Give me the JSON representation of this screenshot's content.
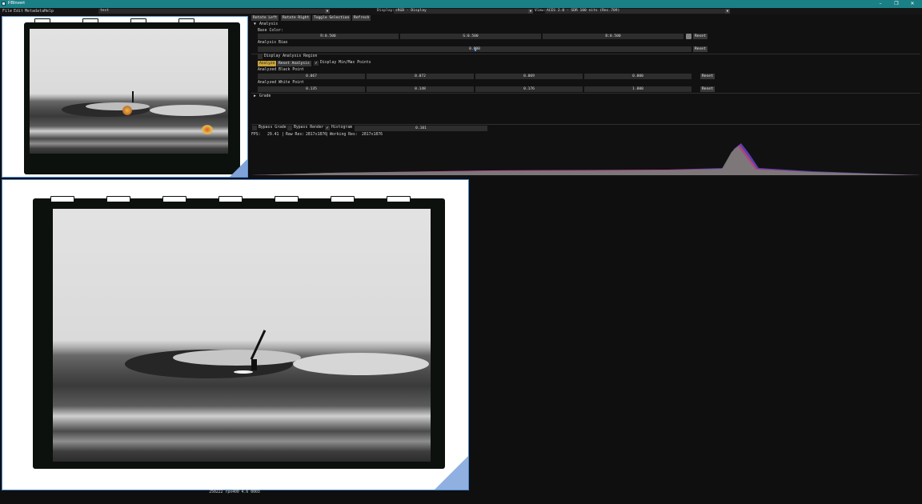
{
  "window": {
    "title": "FBInvert",
    "icon": "app-icon",
    "controls": [
      "–",
      "❐",
      "✕"
    ]
  },
  "menu": [
    "File",
    "Edit",
    "Metadata",
    "Help"
  ],
  "toolbar": {
    "file_combo": "test",
    "display_label": "Display:",
    "display_value": "sRGB - Display",
    "view_label": "View:",
    "view_value": "ACES 2.0 - SDR 100 nits (Rec.709)"
  },
  "actions": [
    "Rotate Left",
    "Rotate Right",
    "Toggle Selection",
    "Refresh"
  ],
  "analysis": {
    "header": "Analysis",
    "expander_icon": "triangle-down-icon",
    "base_color_label": "Base Color:",
    "base_color_values": [
      "R:0.500",
      "G:0.500",
      "B:0.500"
    ],
    "base_color_swatch": "#808080",
    "analysis_bias_label": "Analysis Bias",
    "analysis_bias_value": "0.000",
    "analysis_bias_fraction": 0.5,
    "display_region_label": "Display Analysis Region",
    "display_region_checked": false,
    "analyze_label": "Analyze",
    "reset_analysis_label": "Reset Analysis",
    "minmax_label": "Display Min/Max Points",
    "minmax_checked": true,
    "black_point_label": "Analyzed Black Point",
    "black_point_values": [
      "0.067",
      "0.072",
      "0.069",
      "0.000"
    ],
    "white_point_label": "Analyzed White Point",
    "white_point_values": [
      "0.135",
      "0.148",
      "0.176",
      "1.000"
    ],
    "reset_label": "Reset"
  },
  "grade": {
    "header": "Grade",
    "expander_icon": "triangle-right-icon"
  },
  "bottom": {
    "bypass_grade": "Bypass Grade",
    "bypass_render": "Bypass Render",
    "histogram": "Histogram",
    "histogram_checked": true,
    "slider_value": "0.101",
    "fps_label": "FPS:",
    "fps_value": "29.41",
    "raw_res_label": "Raw Res:",
    "raw_res_value": "2817x1876",
    "working_res_label": "Working Res:",
    "working_res_value": "2817x1876"
  },
  "caption": "250222 rpx400 4.6 0003",
  "colors": {
    "accent": "#1b7f86",
    "frame_border": "#4a8ad6",
    "analyze_highlight": "#c9a23a"
  }
}
